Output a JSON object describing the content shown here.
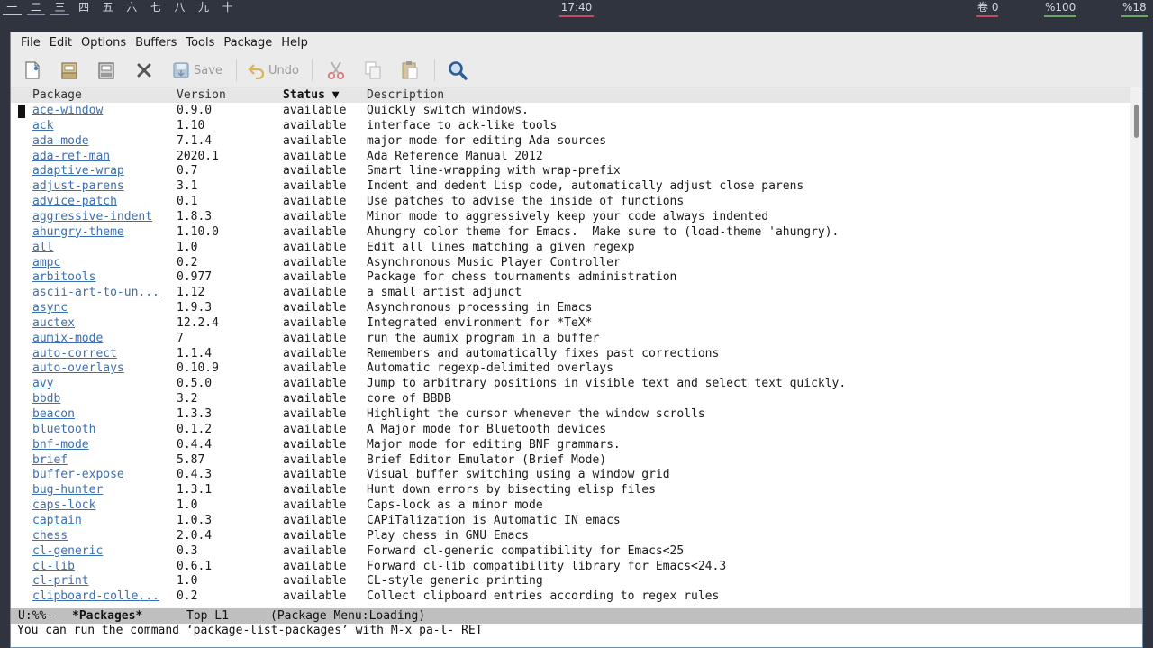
{
  "topbar": {
    "workspaces": [
      "一",
      "二",
      "三",
      "四",
      "五",
      "六",
      "七",
      "八",
      "九",
      "十"
    ],
    "clock": "17:40",
    "tray": [
      "卷 0",
      "%100",
      "%18"
    ],
    "colors": {
      "clock_underline": "#c84a5e",
      "tray_red": "#c84a5e",
      "tray_green": "#6aa86a"
    }
  },
  "menubar": [
    "File",
    "Edit",
    "Options",
    "Buffers",
    "Tools",
    "Package",
    "Help"
  ],
  "toolbar": {
    "save_label": "Save",
    "undo_label": "Undo",
    "icons": [
      "new-file-icon",
      "open-folder-icon",
      "open-directory-icon",
      "close-icon",
      "save-icon",
      "undo-icon",
      "cut-icon",
      "copy-icon",
      "paste-icon",
      "search-icon"
    ]
  },
  "columns": {
    "package": "Package",
    "version": "Version",
    "status": "Status ▼",
    "description": "Description"
  },
  "packages": [
    {
      "name": "ace-window",
      "version": "0.9.0",
      "status": "available",
      "description": "Quickly switch windows."
    },
    {
      "name": "ack",
      "version": "1.10",
      "status": "available",
      "description": "interface to ack-like tools"
    },
    {
      "name": "ada-mode",
      "version": "7.1.4",
      "status": "available",
      "description": "major-mode for editing Ada sources"
    },
    {
      "name": "ada-ref-man",
      "version": "2020.1",
      "status": "available",
      "description": "Ada Reference Manual 2012"
    },
    {
      "name": "adaptive-wrap",
      "version": "0.7",
      "status": "available",
      "description": "Smart line-wrapping with wrap-prefix"
    },
    {
      "name": "adjust-parens",
      "version": "3.1",
      "status": "available",
      "description": "Indent and dedent Lisp code, automatically adjust close parens"
    },
    {
      "name": "advice-patch",
      "version": "0.1",
      "status": "available",
      "description": "Use patches to advise the inside of functions"
    },
    {
      "name": "aggressive-indent",
      "version": "1.8.3",
      "status": "available",
      "description": "Minor mode to aggressively keep your code always indented"
    },
    {
      "name": "ahungry-theme",
      "version": "1.10.0",
      "status": "available",
      "description": "Ahungry color theme for Emacs.  Make sure to (load-theme 'ahungry)."
    },
    {
      "name": "all",
      "version": "1.0",
      "status": "available",
      "description": "Edit all lines matching a given regexp"
    },
    {
      "name": "ampc",
      "version": "0.2",
      "status": "available",
      "description": "Asynchronous Music Player Controller"
    },
    {
      "name": "arbitools",
      "version": "0.977",
      "status": "available",
      "description": "Package for chess tournaments administration"
    },
    {
      "name": "ascii-art-to-un...",
      "version": "1.12",
      "status": "available",
      "description": "a small artist adjunct"
    },
    {
      "name": "async",
      "version": "1.9.3",
      "status": "available",
      "description": "Asynchronous processing in Emacs"
    },
    {
      "name": "auctex",
      "version": "12.2.4",
      "status": "available",
      "description": "Integrated environment for *TeX*"
    },
    {
      "name": "aumix-mode",
      "version": "7",
      "status": "available",
      "description": "run the aumix program in a buffer"
    },
    {
      "name": "auto-correct",
      "version": "1.1.4",
      "status": "available",
      "description": "Remembers and automatically fixes past corrections"
    },
    {
      "name": "auto-overlays",
      "version": "0.10.9",
      "status": "available",
      "description": "Automatic regexp-delimited overlays"
    },
    {
      "name": "avy",
      "version": "0.5.0",
      "status": "available",
      "description": "Jump to arbitrary positions in visible text and select text quickly."
    },
    {
      "name": "bbdb",
      "version": "3.2",
      "status": "available",
      "description": "core of BBDB"
    },
    {
      "name": "beacon",
      "version": "1.3.3",
      "status": "available",
      "description": "Highlight the cursor whenever the window scrolls"
    },
    {
      "name": "bluetooth",
      "version": "0.1.2",
      "status": "available",
      "description": "A Major mode for Bluetooth devices"
    },
    {
      "name": "bnf-mode",
      "version": "0.4.4",
      "status": "available",
      "description": "Major mode for editing BNF grammars."
    },
    {
      "name": "brief",
      "version": "5.87",
      "status": "available",
      "description": "Brief Editor Emulator (Brief Mode)"
    },
    {
      "name": "buffer-expose",
      "version": "0.4.3",
      "status": "available",
      "description": "Visual buffer switching using a window grid"
    },
    {
      "name": "bug-hunter",
      "version": "1.3.1",
      "status": "available",
      "description": "Hunt down errors by bisecting elisp files"
    },
    {
      "name": "caps-lock",
      "version": "1.0",
      "status": "available",
      "description": "Caps-lock as a minor mode"
    },
    {
      "name": "captain",
      "version": "1.0.3",
      "status": "available",
      "description": "CAPiTalization is Automatic IN emacs"
    },
    {
      "name": "chess",
      "version": "2.0.4",
      "status": "available",
      "description": "Play chess in GNU Emacs"
    },
    {
      "name": "cl-generic",
      "version": "0.3",
      "status": "available",
      "description": "Forward cl-generic compatibility for Emacs<25"
    },
    {
      "name": "cl-lib",
      "version": "0.6.1",
      "status": "available",
      "description": "Forward cl-lib compatibility library for Emacs<24.3"
    },
    {
      "name": "cl-print",
      "version": "1.0",
      "status": "available",
      "description": "CL-style generic printing"
    },
    {
      "name": "clipboard-colle...",
      "version": "0.2",
      "status": "available",
      "description": "Collect clipboard entries according to regex rules"
    }
  ],
  "modeline": {
    "state": "U:%%-",
    "buffer": "*Packages*",
    "position": "Top L1",
    "mode": "(Package Menu:Loading)"
  },
  "echo": "You can run the command ‘package-list-packages’ with M-x pa-l- RET"
}
